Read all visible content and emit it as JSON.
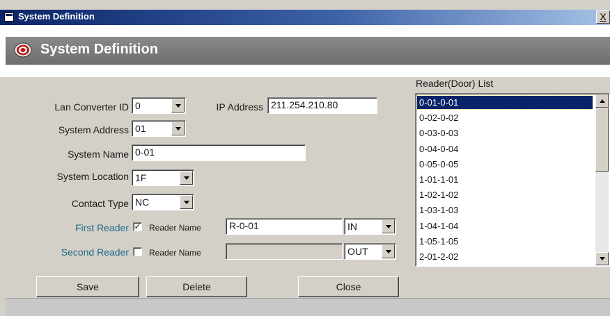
{
  "window": {
    "title": "System Definition",
    "close_label": "X"
  },
  "header": {
    "title": "System Definition",
    "logo_icon": "target-logo-icon"
  },
  "form": {
    "lan_converter_id": {
      "label": "Lan Converter ID",
      "value": "0"
    },
    "ip_address": {
      "label": "IP Address",
      "value": "211.254.210.80"
    },
    "system_address": {
      "label": "System Address",
      "value": "01"
    },
    "system_name": {
      "label": "System Name",
      "value": "0-01"
    },
    "system_location": {
      "label": "System Location",
      "value": "1F"
    },
    "contact_type": {
      "label": "Contact Type",
      "value": "NC"
    },
    "first_reader": {
      "label": "First Reader",
      "checked": true,
      "name_label": "Reader Name",
      "name_value": "R-0-01",
      "direction": "IN"
    },
    "second_reader": {
      "label": "Second Reader",
      "checked": false,
      "name_label": "Reader Name",
      "name_value": "",
      "direction": "OUT"
    }
  },
  "buttons": {
    "save": "Save",
    "delete": "Delete",
    "close": "Close"
  },
  "reader_list": {
    "title": "Reader(Door) List",
    "items": [
      "0-01-0-01",
      "0-02-0-02",
      "0-03-0-03",
      "0-04-0-04",
      "0-05-0-05",
      "1-01-1-01",
      "1-02-1-02",
      "1-03-1-03",
      "1-04-1-04",
      "1-05-1-05",
      "2-01-2-02"
    ],
    "selected_index": 0
  },
  "colors": {
    "title_bar": "#0a2468",
    "selection": "#0a246a",
    "reader_label": "#1f6b8a"
  }
}
